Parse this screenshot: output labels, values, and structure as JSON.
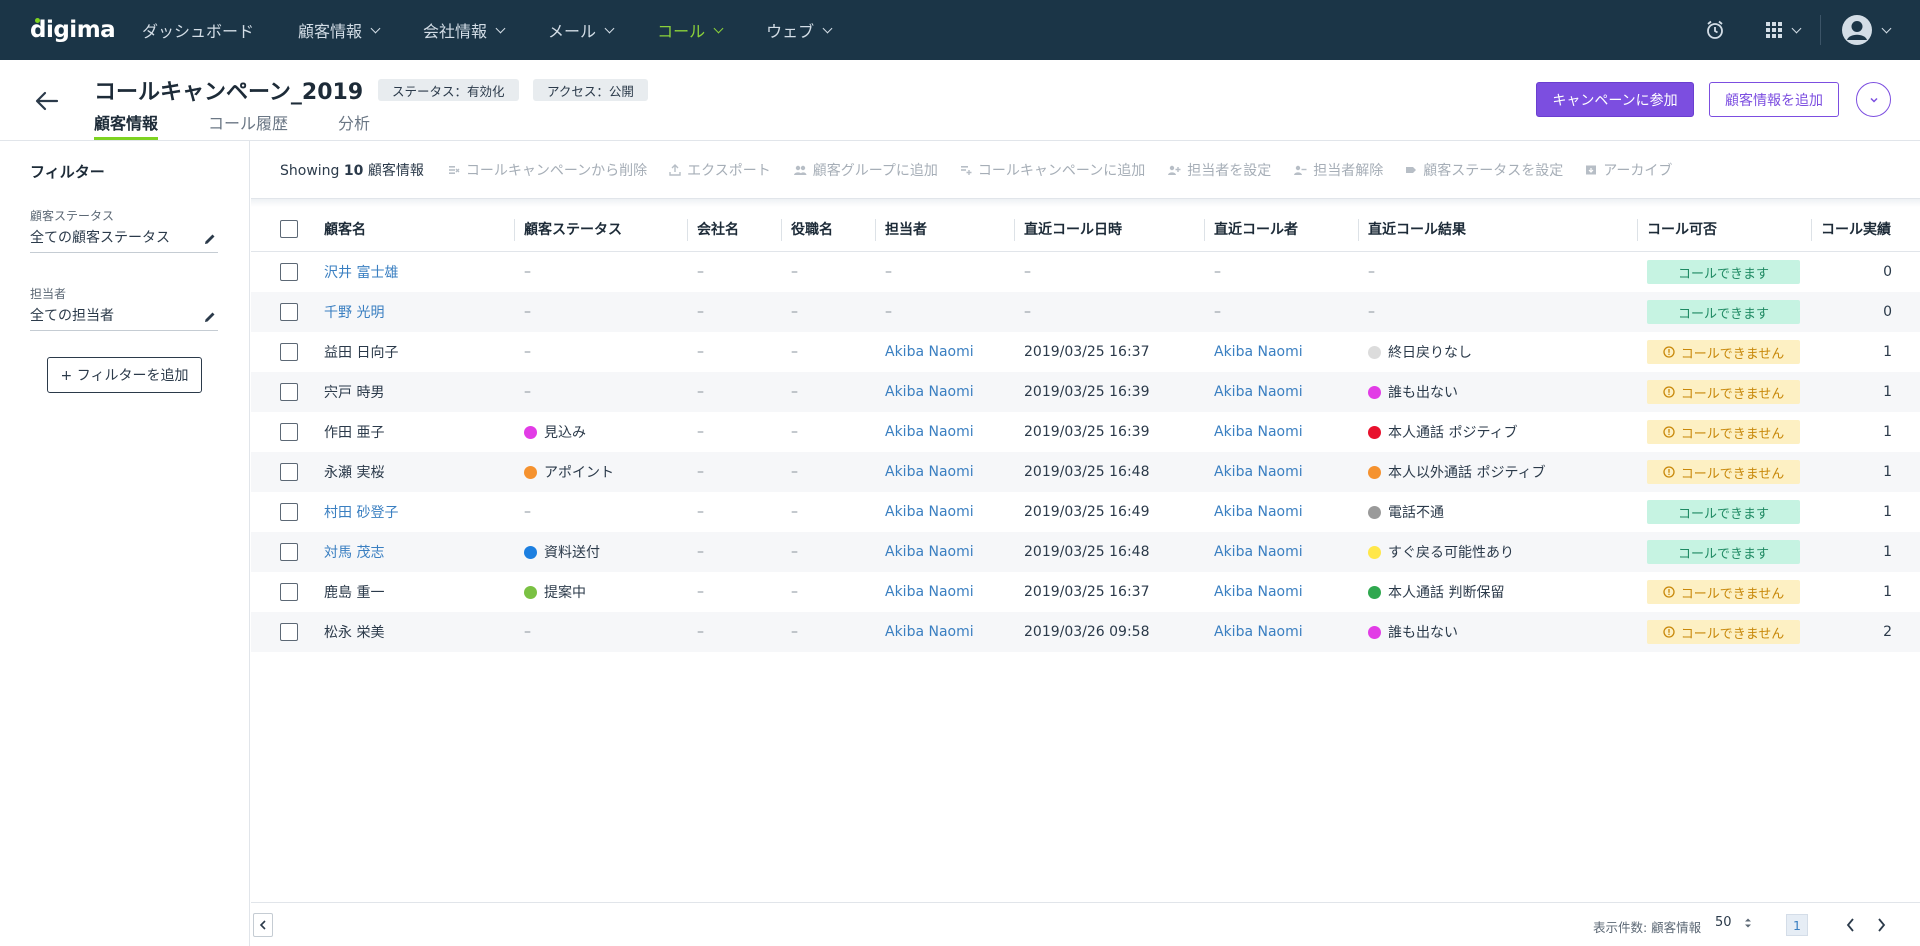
{
  "app": {
    "logo": "digima"
  },
  "nav": {
    "items": [
      {
        "label": "ダッシュボード",
        "dropdown": false,
        "active": false
      },
      {
        "label": "顧客情報",
        "dropdown": true,
        "active": false
      },
      {
        "label": "会社情報",
        "dropdown": true,
        "active": false
      },
      {
        "label": "メール",
        "dropdown": true,
        "active": false
      },
      {
        "label": "コール",
        "dropdown": true,
        "active": true
      },
      {
        "label": "ウェブ",
        "dropdown": true,
        "active": false
      }
    ],
    "right_icons": [
      "alarm-clock-icon",
      "apps-grid-icon",
      "user-avatar-icon"
    ]
  },
  "header": {
    "title": "コールキャンペーン_2019",
    "status_pill": "ステータス：有効化",
    "access_pill": "アクセス：公開",
    "tabs": [
      {
        "label": "顧客情報",
        "active": true
      },
      {
        "label": "コール履歴",
        "active": false
      },
      {
        "label": "分析",
        "active": false
      }
    ],
    "join_button": "キャンペーンに参加",
    "add_customer_button": "顧客情報を追加"
  },
  "sidebar": {
    "title": "フィルター",
    "filters": [
      {
        "label": "顧客ステータス",
        "value": "全ての顧客ステータス"
      },
      {
        "label": "担当者",
        "value": "全ての担当者"
      }
    ],
    "add_filter": "+ フィルターを追加"
  },
  "toolbar": {
    "showing_prefix": "Showing",
    "showing_count": "10",
    "showing_suffix": "顧客情報",
    "actions": [
      {
        "label": "コールキャンペーンから削除",
        "icon": "remove-list-icon"
      },
      {
        "label": "エクスポート",
        "icon": "export-icon"
      },
      {
        "label": "顧客グループに追加",
        "icon": "group-add-icon"
      },
      {
        "label": "コールキャンペーンに追加",
        "icon": "list-add-icon"
      },
      {
        "label": "担当者を設定",
        "icon": "assign-user-icon"
      },
      {
        "label": "担当者解除",
        "icon": "unassign-user-icon"
      },
      {
        "label": "顧客ステータスを設定",
        "icon": "tag-icon"
      },
      {
        "label": "アーカイブ",
        "icon": "archive-icon"
      }
    ]
  },
  "table": {
    "columns": [
      "顧客名",
      "顧客ステータス",
      "会社名",
      "役職名",
      "担当者",
      "直近コール日時",
      "直近コール者",
      "直近コール結果",
      "コール可否",
      "コール実績"
    ],
    "rows": [
      {
        "name": "沢井 富士雄",
        "name_link": true,
        "status": "–",
        "status_color": "",
        "company": "–",
        "title": "–",
        "owner": "–",
        "last_call": "–",
        "caller": "–",
        "result": "–",
        "result_color": "",
        "callable": "コールできます",
        "callable_ok": true,
        "count": "0"
      },
      {
        "name": "千野 光明",
        "name_link": true,
        "status": "–",
        "status_color": "",
        "company": "–",
        "title": "–",
        "owner": "–",
        "last_call": "–",
        "caller": "–",
        "result": "–",
        "result_color": "",
        "callable": "コールできます",
        "callable_ok": true,
        "count": "0"
      },
      {
        "name": "益田 日向子",
        "name_link": false,
        "status": "–",
        "status_color": "",
        "company": "–",
        "title": "–",
        "owner": "Akiba Naomi",
        "last_call": "2019/03/25 16:37",
        "caller": "Akiba Naomi",
        "result": "終日戻りなし",
        "result_color": "#dcdcdc",
        "callable": "コールできません",
        "callable_ok": false,
        "count": "1"
      },
      {
        "name": "宍戸 時男",
        "name_link": false,
        "status": "–",
        "status_color": "",
        "company": "–",
        "title": "–",
        "owner": "Akiba Naomi",
        "last_call": "2019/03/25 16:39",
        "caller": "Akiba Naomi",
        "result": "誰も出ない",
        "result_color": "#e23ce6",
        "callable": "コールできません",
        "callable_ok": false,
        "count": "1"
      },
      {
        "name": "作田 亜子",
        "name_link": false,
        "status": "見込み",
        "status_color": "#e23ce6",
        "company": "–",
        "title": "–",
        "owner": "Akiba Naomi",
        "last_call": "2019/03/25 16:39",
        "caller": "Akiba Naomi",
        "result": "本人通話 ポジティブ",
        "result_color": "#e8112d",
        "callable": "コールできません",
        "callable_ok": false,
        "count": "1"
      },
      {
        "name": "永瀬 実桜",
        "name_link": false,
        "status": "アポイント",
        "status_color": "#f5922f",
        "company": "–",
        "title": "–",
        "owner": "Akiba Naomi",
        "last_call": "2019/03/25 16:48",
        "caller": "Akiba Naomi",
        "result": "本人以外通話 ポジティブ",
        "result_color": "#f5922f",
        "callable": "コールできません",
        "callable_ok": false,
        "count": "1"
      },
      {
        "name": "村田 砂登子",
        "name_link": true,
        "status": "–",
        "status_color": "",
        "company": "–",
        "title": "–",
        "owner": "Akiba Naomi",
        "last_call": "2019/03/25 16:49",
        "caller": "Akiba Naomi",
        "result": "電話不通",
        "result_color": "#9a9a9a",
        "callable": "コールできます",
        "callable_ok": true,
        "count": "1"
      },
      {
        "name": "対馬 茂志",
        "name_link": true,
        "status": "資料送付",
        "status_color": "#1c7fe0",
        "company": "–",
        "title": "–",
        "owner": "Akiba Naomi",
        "last_call": "2019/03/25 16:48",
        "caller": "Akiba Naomi",
        "result": "すぐ戻る可能性あり",
        "result_color": "#ffe74a",
        "callable": "コールできます",
        "callable_ok": true,
        "count": "1"
      },
      {
        "name": "鹿島 重一",
        "name_link": false,
        "status": "提案中",
        "status_color": "#7ac143",
        "company": "–",
        "title": "–",
        "owner": "Akiba Naomi",
        "last_call": "2019/03/25 16:37",
        "caller": "Akiba Naomi",
        "result": "本人通話 判断保留",
        "result_color": "#2fa84f",
        "callable": "コールできません",
        "callable_ok": false,
        "count": "1"
      },
      {
        "name": "松永 栄美",
        "name_link": false,
        "status": "–",
        "status_color": "",
        "company": "–",
        "title": "–",
        "owner": "Akiba Naomi",
        "last_call": "2019/03/26 09:58",
        "caller": "Akiba Naomi",
        "result": "誰も出ない",
        "result_color": "#e23ce6",
        "callable": "コールできません",
        "callable_ok": false,
        "count": "2"
      }
    ]
  },
  "footer": {
    "per_page_label": "表示件数: 顧客情報",
    "per_page_value": "50",
    "current_page": "1"
  }
}
